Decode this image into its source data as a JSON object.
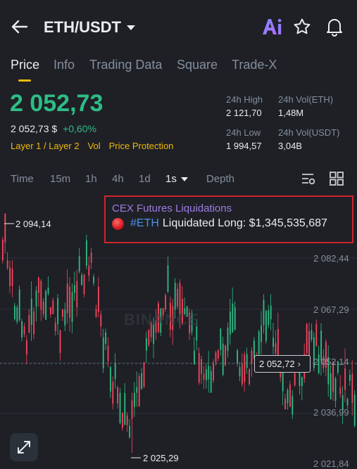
{
  "header": {
    "pair": "ETH/USDT",
    "ai_label": "Ai"
  },
  "tabs": [
    "Price",
    "Info",
    "Trading Data",
    "Square",
    "Trade-X"
  ],
  "ticker": {
    "last_price": "2 052,73",
    "price_usd": "2 052,73 $",
    "change_pct": "+0,60%",
    "tags": [
      "Layer 1 / Layer 2",
      "Vol",
      "Price Protection"
    ],
    "high_label": "24h High",
    "high_value": "2 121,70",
    "vol_eth_label": "24h Vol(ETH)",
    "vol_eth_value": "1,48M",
    "low_label": "24h Low",
    "low_value": "1 994,57",
    "vol_usdt_label": "24h Vol(USDT)",
    "vol_usdt_value": "3,04B"
  },
  "timeframes": {
    "items": [
      "Time",
      "15m",
      "1h",
      "4h",
      "1d",
      "1s",
      "Depth"
    ],
    "active": "1s"
  },
  "notice": {
    "title": "CEX Futures Liquidations",
    "hashtag": "#ETH",
    "text": "Liquidated Long: $1,345,535,687"
  },
  "chart": {
    "axis_labels": [
      "2 082,44",
      "2 067,29",
      "2 052,14",
      "2 036,99",
      "2 021,84"
    ],
    "high_marker": "2 094,14",
    "low_marker": "2 025,29",
    "current_price": "2 052,72",
    "watermark": "BINANCE"
  },
  "colors": {
    "up": "#2ebd85",
    "down": "#f6465d",
    "accent": "#f0b90b",
    "background": "#1e2026"
  }
}
